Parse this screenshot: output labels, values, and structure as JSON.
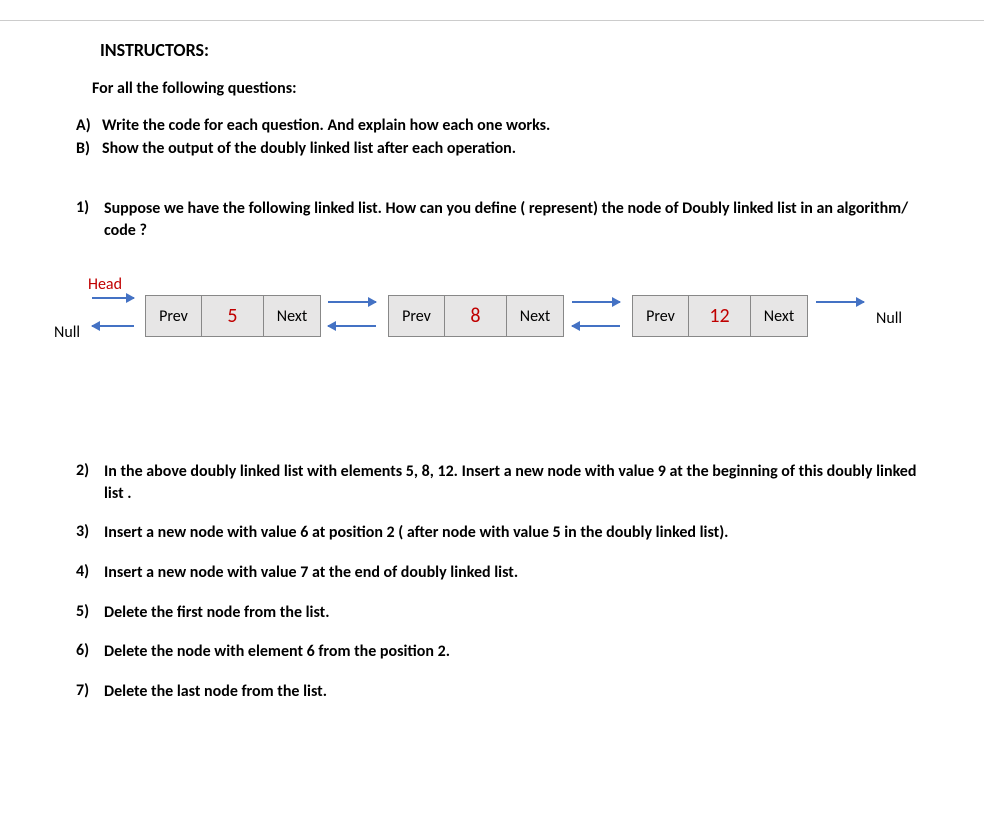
{
  "title": "INSTRUCTORS:",
  "subtitle": "For all the following questions:",
  "lettered": [
    {
      "label": "A)",
      "text": "Write the code for each question. And explain how each one works."
    },
    {
      "label": "B)",
      "text": "Show the output of the doubly linked list after each operation."
    }
  ],
  "q1": {
    "label": "1)",
    "text": "Suppose we have the following linked list.  How can you define ( represent)  the node of Doubly linked list in an algorithm/ code ?"
  },
  "diagram": {
    "head": "Head",
    "null_left": "Null",
    "null_right": "Null",
    "prev": "Prev",
    "next": "Next",
    "nodes": [
      "5",
      "8",
      "12"
    ]
  },
  "questions": [
    {
      "label": "2)",
      "text": "In the above doubly linked list with elements 5, 8, 12. Insert a new node with value 9 at the beginning of this doubly linked list ."
    },
    {
      "label": "3)",
      "text": "Insert  a new node with value 6 at position 2 ( after node with value 5 in the doubly linked list)."
    },
    {
      "label": "4)",
      "text": "Insert a new node with value 7 at the end of doubly linked list."
    },
    {
      "label": "5)",
      "text": "Delete the first node from the list."
    },
    {
      "label": "6)",
      "text": "Delete the node with element 6 from the position 2."
    },
    {
      "label": "7)",
      "text": "Delete the last node from the list."
    }
  ]
}
